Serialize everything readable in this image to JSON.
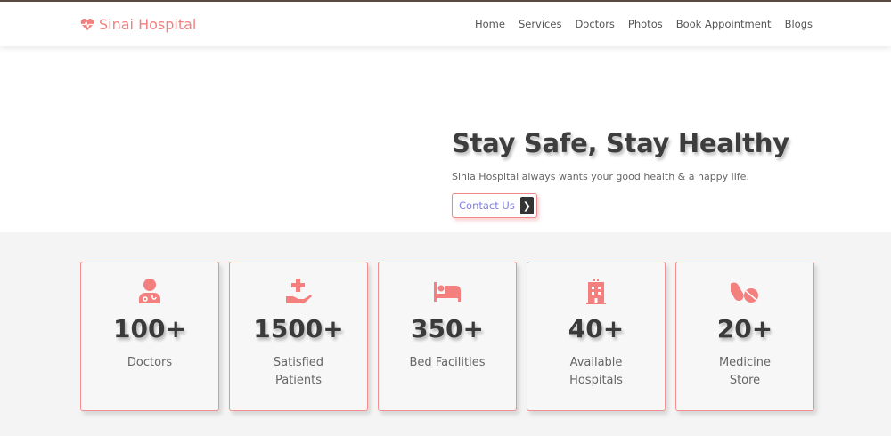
{
  "colors": {
    "accent": "#f37f7f",
    "link": "#7f7fe0"
  },
  "header": {
    "logo_text": "Sinai Hospital",
    "logo_icon": "heart-pulse-icon",
    "nav": [
      "Home",
      "Services",
      "Doctors",
      "Photos",
      "Book Appointment",
      "Blogs"
    ]
  },
  "hero": {
    "title": "Stay Safe, Stay Healthy",
    "subtitle": "Sinia Hospital always wants your good health & a happy life.",
    "button_label": "Contact Us",
    "button_icon": "chevron-right-icon"
  },
  "stats": [
    {
      "value": "100+",
      "label": "Doctors",
      "icon": "doctor-icon"
    },
    {
      "value": "1500+",
      "label": "Satisfied Patients",
      "icon": "hand-medical-icon"
    },
    {
      "value": "350+",
      "label": "Bed Facilities",
      "icon": "bed-icon"
    },
    {
      "value": "40+",
      "label": "Available Hospitals",
      "icon": "hospital-icon"
    },
    {
      "value": "20+",
      "label": "Medicine Store",
      "icon": "pills-icon"
    }
  ]
}
